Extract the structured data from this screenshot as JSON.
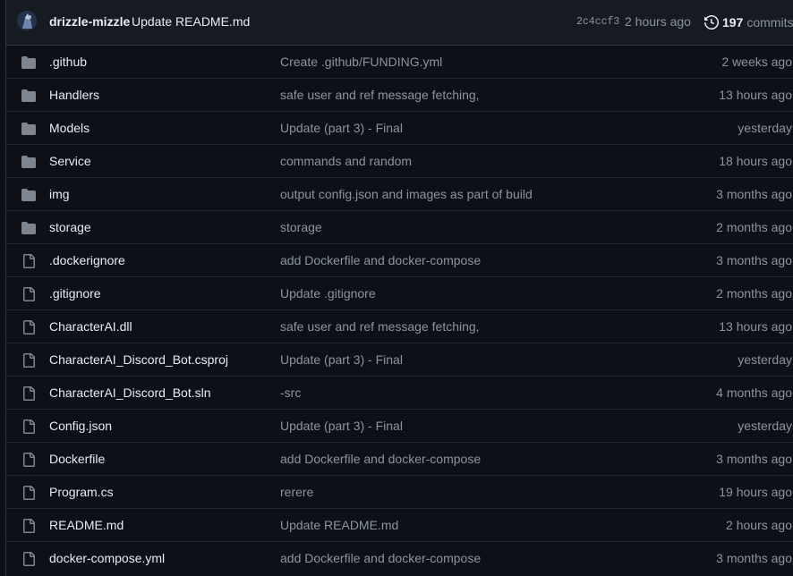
{
  "latest_commit": {
    "author": "drizzle-mizzle",
    "message": "Update README.md",
    "sha": "2c4ccf3",
    "time": "2 hours ago",
    "commit_count": "197",
    "commits_label": "commits"
  },
  "files": [
    {
      "name": ".github",
      "type": "folder",
      "commit": "Create .github/FUNDING.yml",
      "age": "2 weeks ago"
    },
    {
      "name": "Handlers",
      "type": "folder",
      "commit": "safe user and ref message fetching,",
      "age": "13 hours ago"
    },
    {
      "name": "Models",
      "type": "folder",
      "commit": "Update (part 3) - Final",
      "age": "yesterday"
    },
    {
      "name": "Service",
      "type": "folder",
      "commit": "commands and random",
      "age": "18 hours ago"
    },
    {
      "name": "img",
      "type": "folder",
      "commit": "output config.json and images as part of build",
      "age": "3 months ago"
    },
    {
      "name": "storage",
      "type": "folder",
      "commit": "storage",
      "age": "2 months ago"
    },
    {
      "name": ".dockerignore",
      "type": "file",
      "commit": "add Dockerfile and docker-compose",
      "age": "3 months ago"
    },
    {
      "name": ".gitignore",
      "type": "file",
      "commit": "Update .gitignore",
      "age": "2 months ago"
    },
    {
      "name": "CharacterAI.dll",
      "type": "file",
      "commit": "safe user and ref message fetching,",
      "age": "13 hours ago"
    },
    {
      "name": "CharacterAI_Discord_Bot.csproj",
      "type": "file",
      "commit": "Update (part 3) - Final",
      "age": "yesterday"
    },
    {
      "name": "CharacterAI_Discord_Bot.sln",
      "type": "file",
      "commit": "-src",
      "age": "4 months ago"
    },
    {
      "name": "Config.json",
      "type": "file",
      "commit": "Update (part 3) - Final",
      "age": "yesterday"
    },
    {
      "name": "Dockerfile",
      "type": "file",
      "commit": "add Dockerfile and docker-compose",
      "age": "3 months ago"
    },
    {
      "name": "Program.cs",
      "type": "file",
      "commit": "rerere",
      "age": "19 hours ago"
    },
    {
      "name": "README.md",
      "type": "file",
      "commit": "Update README.md",
      "age": "2 hours ago"
    },
    {
      "name": "docker-compose.yml",
      "type": "file",
      "commit": "add Dockerfile and docker-compose",
      "age": "3 months ago"
    }
  ],
  "icons": {
    "folder": "folder-icon",
    "file": "file-icon",
    "history": "history-icon"
  },
  "colors": {
    "background": "#0d1117",
    "header_background": "#161b22",
    "border": "#30363d",
    "text": "#e6edf3",
    "muted_text": "#8b949e",
    "icon": "#7d8590"
  }
}
